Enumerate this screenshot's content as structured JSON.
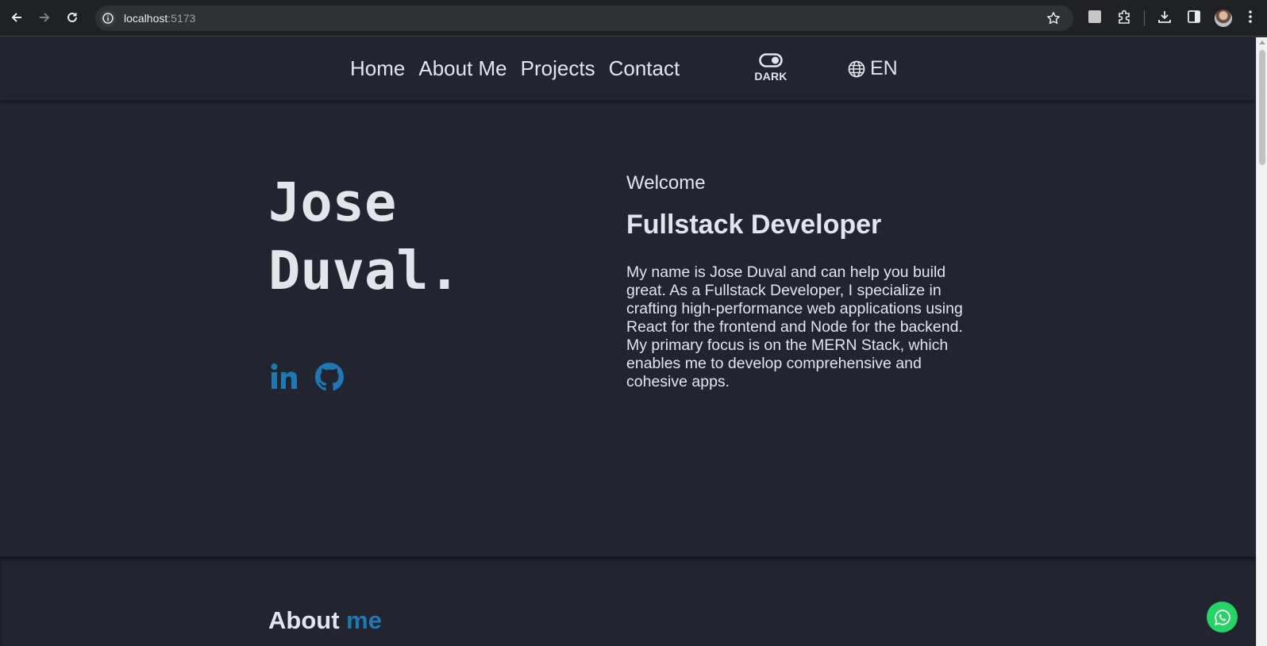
{
  "browser": {
    "url_host": "localhost",
    "url_port": ":5173"
  },
  "nav": {
    "links": [
      "Home",
      "About Me",
      "Projects",
      "Contact"
    ],
    "theme_label": "DARK",
    "language": "EN"
  },
  "hero": {
    "name_line1": "Jose",
    "name_line2": "Duval.",
    "welcome": "Welcome",
    "role": "Fullstack Developer",
    "bio": "My name is Jose Duval and can help you build great. As a Fullstack Developer, I specialize in crafting high-performance web applications using React for the frontend and Node for the backend. My primary focus is on the MERN Stack, which enables me to develop comprehensive and cohesive apps.",
    "social": [
      "linkedin-icon",
      "github-icon"
    ]
  },
  "about": {
    "heading_main": "About",
    "heading_accent": "me"
  },
  "colors": {
    "background": "#22252f",
    "text": "#e3e5ea",
    "accent": "#1f78b4",
    "whatsapp": "#25d366"
  }
}
